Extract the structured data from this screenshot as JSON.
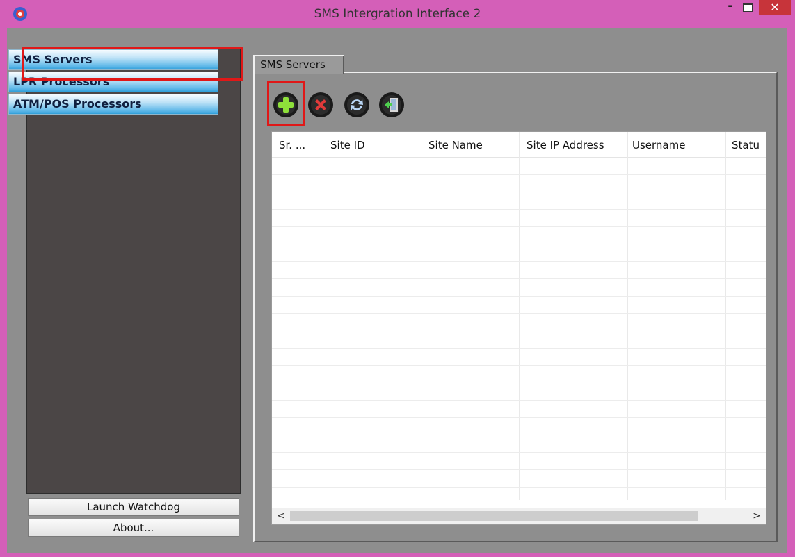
{
  "window": {
    "title": "SMS Intergration Interface 2",
    "minimize_glyph": "-",
    "close_glyph": "✕"
  },
  "sidebar": {
    "items": [
      {
        "label": "SMS Servers"
      },
      {
        "label": "LPR Processors"
      },
      {
        "label": "ATM/POS Processors"
      }
    ],
    "buttons": {
      "launch_watchdog": "Launch Watchdog",
      "about": "About..."
    }
  },
  "tabs": [
    {
      "label": "SMS Servers",
      "active": true
    }
  ],
  "toolbar": [
    {
      "icon": "add-icon"
    },
    {
      "icon": "delete-icon"
    },
    {
      "icon": "refresh-icon"
    },
    {
      "icon": "exit-icon"
    }
  ],
  "table": {
    "columns": [
      "Sr. ...",
      "Site ID",
      "Site Name",
      "Site IP Address",
      "Username",
      "Statu"
    ],
    "rows": []
  },
  "scrollbar": {
    "left_arrow": "<",
    "right_arrow": ">"
  },
  "colors": {
    "window_frame": "#d45fb8",
    "client_bg": "#8e8e8e",
    "sidebar_bg": "#4b4646",
    "highlight": "#e01818",
    "close_button": "#c7343a"
  }
}
